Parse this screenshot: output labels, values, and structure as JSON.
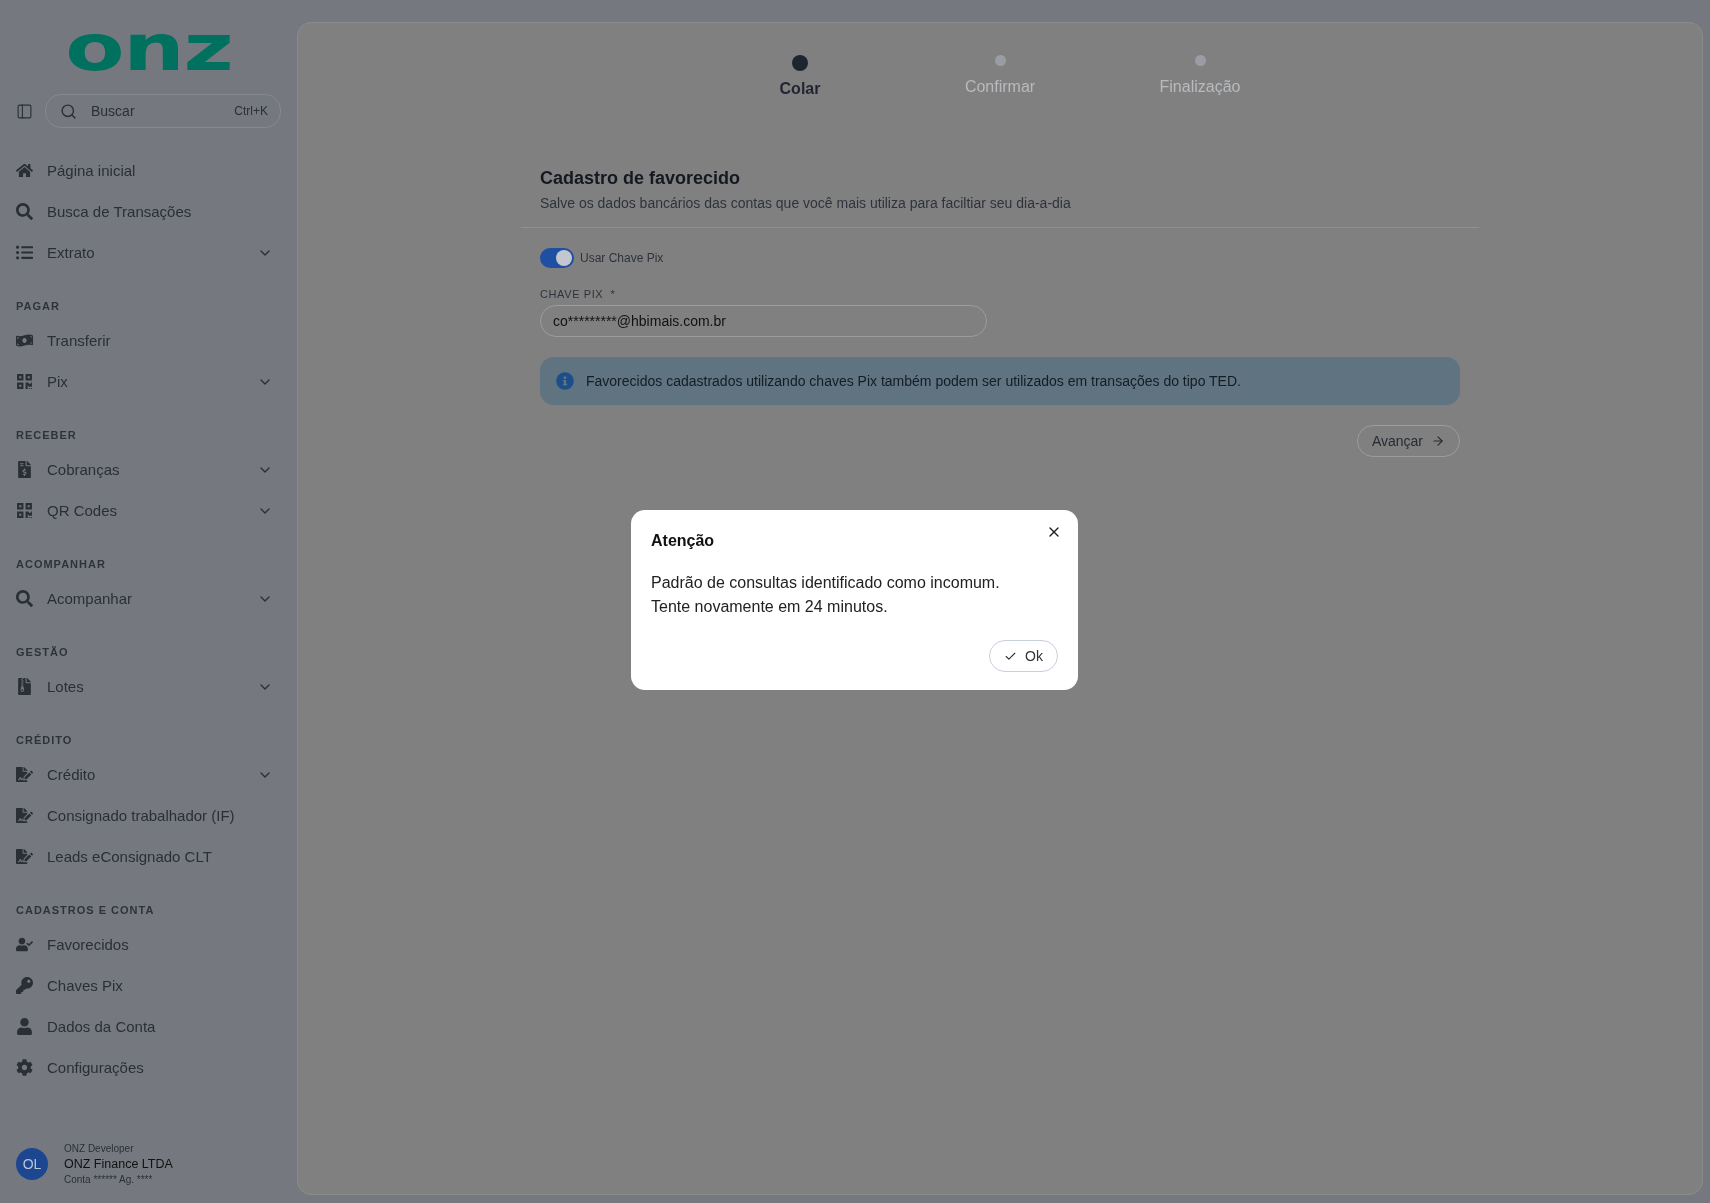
{
  "logo": {
    "text": "onz"
  },
  "sidebar": {
    "search": {
      "placeholder": "Buscar",
      "shortcut": "Ctrl+K"
    },
    "sections": [
      {
        "items": [
          {
            "label": "Página inicial",
            "expandable": false
          },
          {
            "label": "Busca de Transações",
            "expandable": false
          },
          {
            "label": "Extrato",
            "expandable": true
          }
        ]
      },
      {
        "heading": "PAGAR",
        "items": [
          {
            "label": "Transferir",
            "expandable": false
          },
          {
            "label": "Pix",
            "expandable": true
          }
        ]
      },
      {
        "heading": "RECEBER",
        "items": [
          {
            "label": "Cobranças",
            "expandable": true
          },
          {
            "label": "QR Codes",
            "expandable": true
          }
        ]
      },
      {
        "heading": "ACOMPANHAR",
        "items": [
          {
            "label": "Acompanhar",
            "expandable": true
          }
        ]
      },
      {
        "heading": "GESTÃO",
        "items": [
          {
            "label": "Lotes",
            "expandable": true
          }
        ]
      },
      {
        "heading": "CRÉDITO",
        "items": [
          {
            "label": "Crédito",
            "expandable": true
          },
          {
            "label": "Consignado trabalhador (IF)",
            "expandable": false
          },
          {
            "label": "Leads eConsignado CLT",
            "expandable": false
          }
        ]
      },
      {
        "heading": "CADASTROS E CONTA",
        "items": [
          {
            "label": "Favorecidos",
            "expandable": false
          },
          {
            "label": "Chaves Pix",
            "expandable": false
          },
          {
            "label": "Dados da Conta",
            "expandable": false
          },
          {
            "label": "Configurações",
            "expandable": false
          }
        ]
      }
    ],
    "user": {
      "initials": "OL",
      "role": "ONZ Developer",
      "company": "ONZ Finance LTDA",
      "account": "Conta ****** Ag. ****"
    }
  },
  "stepper": [
    {
      "label": "Colar",
      "selected": true
    },
    {
      "label": "Confirmar",
      "selected": false
    },
    {
      "label": "Finalização",
      "selected": false
    }
  ],
  "form": {
    "title": "Cadastro de favorecido",
    "subtitle": "Salve os dados bancários das contas que você mais utiliza para faciltiar seu dia-a-dia",
    "toggle": {
      "label": "Usar Chave Pix",
      "on": true
    },
    "field": {
      "label": "CHAVE PIX",
      "required": "*",
      "value": "co*********@hbimais.com.br"
    },
    "info": "Favorecidos cadastrados utilizando chaves Pix também podem ser utilizados em transações do tipo TED.",
    "next_button": "Avançar"
  },
  "dialog": {
    "title": "Atenção",
    "message": [
      "Padrão de consultas identificado como incomum.",
      "Tente novamente em 24 minutos."
    ],
    "ok_button": "Ok"
  }
}
